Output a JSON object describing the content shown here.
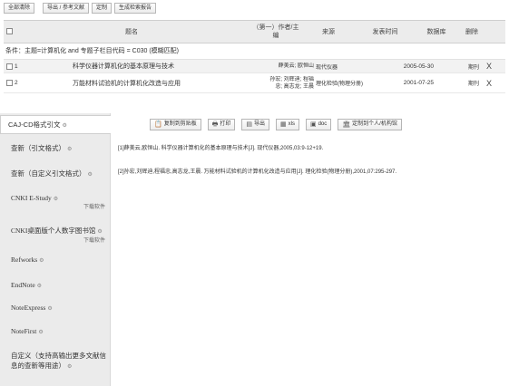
{
  "toolbar": {
    "clear_all": "全部清除",
    "export_refs": "导出 / 参考文献",
    "custom": "定制",
    "gen_report": "生成检索报告"
  },
  "table": {
    "headers": {
      "title": "题名",
      "author": "（第一）作者/主编",
      "source": "来源",
      "date": "发表时间",
      "database": "数据库",
      "delete": "删除"
    },
    "condition": "条件：主题=计算机化 and 专题子栏目代码 = C030 (模糊匹配)",
    "rows": [
      {
        "index": "1",
        "title": "科学仪器计算机化的基本原理与技术",
        "authors": "薛美云; 欧恒山",
        "source": "现代仪器",
        "date": "2005-05-30",
        "database": "期刊",
        "delete": "X"
      },
      {
        "index": "2",
        "title": "万能材料试验机的计算机化改造与应用",
        "authors": "孙宏; 刘辉迪; 程福忠; 高志龙; 王晨",
        "source": "理化检验(物理分册)",
        "date": "2001-07-25",
        "database": "期刊",
        "delete": "X"
      }
    ]
  },
  "sidebar": {
    "items": [
      {
        "label": "CAJ-CD格式引文",
        "sub": ""
      },
      {
        "label": "查新（引文格式）",
        "sub": ""
      },
      {
        "label": "查新（自定义引文格式）",
        "sub": ""
      },
      {
        "label": "CNKI E-Study",
        "sub": "下载软件"
      },
      {
        "label": "CNKI桌面版个人数字图书馆",
        "sub": "下载软件"
      },
      {
        "label": "Refworks",
        "sub": ""
      },
      {
        "label": "EndNote",
        "sub": ""
      },
      {
        "label": "NoteExpress",
        "sub": ""
      },
      {
        "label": "NoteFirst",
        "sub": ""
      },
      {
        "label": "自定义（支持高输出更多文献信息的查新等用途）",
        "sub": ""
      }
    ]
  },
  "export_toolbar": {
    "copy": "复制到剪贴板",
    "print": "打印",
    "export": "导出",
    "xls": "xls",
    "doc": "doc",
    "custom_lib": "定制到个人/机构馆"
  },
  "citations": [
    "[1]薛美云,欧恒山. 科学仪器计算机化的基本原理与技术[J]. 现代仪器,2005,03:9-12+19.",
    "[2]孙宏,刘辉迪,程福忠,高志龙,王晨. 万能材料试验机的计算机化改造与应用[J]. 理化检验(物理分册),2001,07:295-297."
  ]
}
